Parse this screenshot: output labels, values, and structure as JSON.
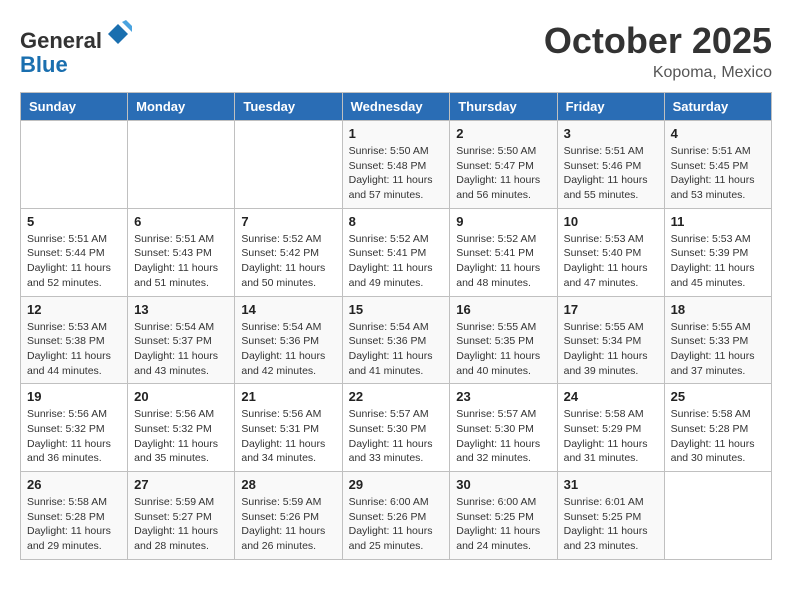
{
  "header": {
    "logo_general": "General",
    "logo_blue": "Blue",
    "month_title": "October 2025",
    "location": "Kopoma, Mexico"
  },
  "weekdays": [
    "Sunday",
    "Monday",
    "Tuesday",
    "Wednesday",
    "Thursday",
    "Friday",
    "Saturday"
  ],
  "weeks": [
    [
      {
        "day": "",
        "info": ""
      },
      {
        "day": "",
        "info": ""
      },
      {
        "day": "",
        "info": ""
      },
      {
        "day": "1",
        "info": "Sunrise: 5:50 AM\nSunset: 5:48 PM\nDaylight: 11 hours\nand 57 minutes."
      },
      {
        "day": "2",
        "info": "Sunrise: 5:50 AM\nSunset: 5:47 PM\nDaylight: 11 hours\nand 56 minutes."
      },
      {
        "day": "3",
        "info": "Sunrise: 5:51 AM\nSunset: 5:46 PM\nDaylight: 11 hours\nand 55 minutes."
      },
      {
        "day": "4",
        "info": "Sunrise: 5:51 AM\nSunset: 5:45 PM\nDaylight: 11 hours\nand 53 minutes."
      }
    ],
    [
      {
        "day": "5",
        "info": "Sunrise: 5:51 AM\nSunset: 5:44 PM\nDaylight: 11 hours\nand 52 minutes."
      },
      {
        "day": "6",
        "info": "Sunrise: 5:51 AM\nSunset: 5:43 PM\nDaylight: 11 hours\nand 51 minutes."
      },
      {
        "day": "7",
        "info": "Sunrise: 5:52 AM\nSunset: 5:42 PM\nDaylight: 11 hours\nand 50 minutes."
      },
      {
        "day": "8",
        "info": "Sunrise: 5:52 AM\nSunset: 5:41 PM\nDaylight: 11 hours\nand 49 minutes."
      },
      {
        "day": "9",
        "info": "Sunrise: 5:52 AM\nSunset: 5:41 PM\nDaylight: 11 hours\nand 48 minutes."
      },
      {
        "day": "10",
        "info": "Sunrise: 5:53 AM\nSunset: 5:40 PM\nDaylight: 11 hours\nand 47 minutes."
      },
      {
        "day": "11",
        "info": "Sunrise: 5:53 AM\nSunset: 5:39 PM\nDaylight: 11 hours\nand 45 minutes."
      }
    ],
    [
      {
        "day": "12",
        "info": "Sunrise: 5:53 AM\nSunset: 5:38 PM\nDaylight: 11 hours\nand 44 minutes."
      },
      {
        "day": "13",
        "info": "Sunrise: 5:54 AM\nSunset: 5:37 PM\nDaylight: 11 hours\nand 43 minutes."
      },
      {
        "day": "14",
        "info": "Sunrise: 5:54 AM\nSunset: 5:36 PM\nDaylight: 11 hours\nand 42 minutes."
      },
      {
        "day": "15",
        "info": "Sunrise: 5:54 AM\nSunset: 5:36 PM\nDaylight: 11 hours\nand 41 minutes."
      },
      {
        "day": "16",
        "info": "Sunrise: 5:55 AM\nSunset: 5:35 PM\nDaylight: 11 hours\nand 40 minutes."
      },
      {
        "day": "17",
        "info": "Sunrise: 5:55 AM\nSunset: 5:34 PM\nDaylight: 11 hours\nand 39 minutes."
      },
      {
        "day": "18",
        "info": "Sunrise: 5:55 AM\nSunset: 5:33 PM\nDaylight: 11 hours\nand 37 minutes."
      }
    ],
    [
      {
        "day": "19",
        "info": "Sunrise: 5:56 AM\nSunset: 5:32 PM\nDaylight: 11 hours\nand 36 minutes."
      },
      {
        "day": "20",
        "info": "Sunrise: 5:56 AM\nSunset: 5:32 PM\nDaylight: 11 hours\nand 35 minutes."
      },
      {
        "day": "21",
        "info": "Sunrise: 5:56 AM\nSunset: 5:31 PM\nDaylight: 11 hours\nand 34 minutes."
      },
      {
        "day": "22",
        "info": "Sunrise: 5:57 AM\nSunset: 5:30 PM\nDaylight: 11 hours\nand 33 minutes."
      },
      {
        "day": "23",
        "info": "Sunrise: 5:57 AM\nSunset: 5:30 PM\nDaylight: 11 hours\nand 32 minutes."
      },
      {
        "day": "24",
        "info": "Sunrise: 5:58 AM\nSunset: 5:29 PM\nDaylight: 11 hours\nand 31 minutes."
      },
      {
        "day": "25",
        "info": "Sunrise: 5:58 AM\nSunset: 5:28 PM\nDaylight: 11 hours\nand 30 minutes."
      }
    ],
    [
      {
        "day": "26",
        "info": "Sunrise: 5:58 AM\nSunset: 5:28 PM\nDaylight: 11 hours\nand 29 minutes."
      },
      {
        "day": "27",
        "info": "Sunrise: 5:59 AM\nSunset: 5:27 PM\nDaylight: 11 hours\nand 28 minutes."
      },
      {
        "day": "28",
        "info": "Sunrise: 5:59 AM\nSunset: 5:26 PM\nDaylight: 11 hours\nand 26 minutes."
      },
      {
        "day": "29",
        "info": "Sunrise: 6:00 AM\nSunset: 5:26 PM\nDaylight: 11 hours\nand 25 minutes."
      },
      {
        "day": "30",
        "info": "Sunrise: 6:00 AM\nSunset: 5:25 PM\nDaylight: 11 hours\nand 24 minutes."
      },
      {
        "day": "31",
        "info": "Sunrise: 6:01 AM\nSunset: 5:25 PM\nDaylight: 11 hours\nand 23 minutes."
      },
      {
        "day": "",
        "info": ""
      }
    ]
  ]
}
